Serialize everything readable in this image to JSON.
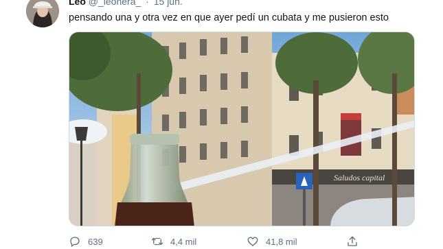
{
  "tweet": {
    "author_name": "Leo",
    "handle": "@_leonera_",
    "separator": "·",
    "date": "15 jun.",
    "text": "pensando una y otra vez en que ayer pedí un cubata y me pusieron esto"
  },
  "media": {
    "sign_text": "Saludos capital"
  },
  "actions": {
    "replies": "639",
    "retweets": "4,4 mil",
    "likes": "41,8 mil"
  },
  "icons": [
    "avatar",
    "reply-icon",
    "retweet-icon",
    "like-icon",
    "share-icon"
  ]
}
